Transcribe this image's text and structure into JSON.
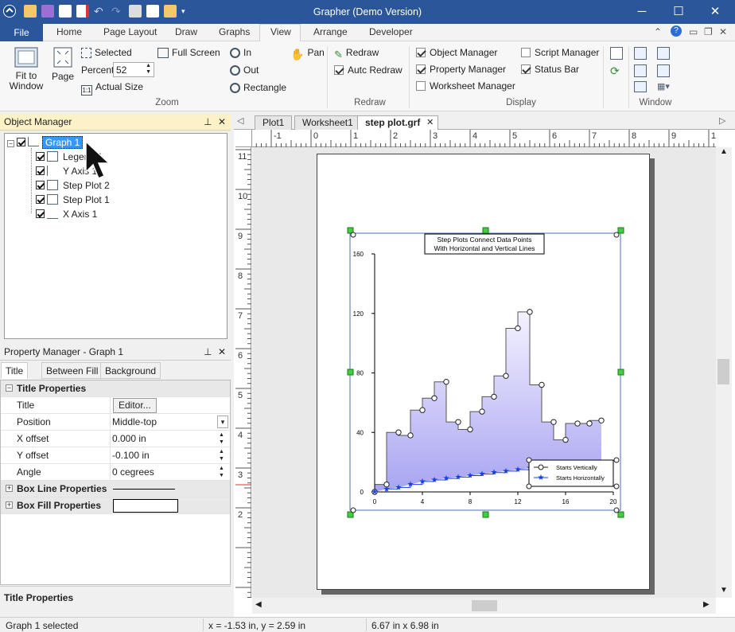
{
  "app": {
    "title": "Grapher (Demo Version)"
  },
  "ribbon_tabs": [
    {
      "label": "File"
    },
    {
      "label": "Home"
    },
    {
      "label": "Page Layout"
    },
    {
      "label": "Draw"
    },
    {
      "label": "Graphs"
    },
    {
      "label": "View"
    },
    {
      "label": "Arrange"
    },
    {
      "label": "Developer"
    }
  ],
  "zoom": {
    "fit_label": "Fit to\nWindow",
    "page_label": "Page",
    "selected_label": "Selected",
    "percent_label": "Percent",
    "percent_value": "52",
    "actual_label": "Actual Size",
    "fullscreen_label": "Full Screen",
    "in_label": "In",
    "out_label": "Out",
    "rect_label": "Rectangle",
    "pan_label": "Pan",
    "group_label": "Zoom"
  },
  "redraw": {
    "redraw_label": "Redraw",
    "auto_label": "Autc Redraw",
    "group_label": "Redraw",
    "auto_checked": true
  },
  "display": {
    "object_manager": "Object Manager",
    "property_manager": "Property Manager",
    "worksheet_manager": "Worksheet Manager",
    "script_manager": "Script Manager",
    "status_bar": "Status Bar",
    "group_label": "Display"
  },
  "window": {
    "group_label": "Window"
  },
  "object_manager": {
    "title": "Object Manager",
    "items": [
      {
        "label": "Graph 1"
      },
      {
        "label": "Legend 1"
      },
      {
        "label": "Y Axis 1"
      },
      {
        "label": "Step Plot 2"
      },
      {
        "label": "Step Plot 1"
      },
      {
        "label": "X Axis 1"
      }
    ]
  },
  "property_manager": {
    "title": "Property Manager - Graph 1",
    "tabs": [
      {
        "label": "Title"
      },
      {
        "label": "Between Fill"
      },
      {
        "label": "Background"
      }
    ],
    "cat_title": "Title Properties",
    "rows": [
      {
        "key": "Title",
        "value": "Editor..."
      },
      {
        "key": "Position",
        "value": "Middle-top"
      },
      {
        "key": "X offset",
        "value": "0.000 in"
      },
      {
        "key": "Y offset",
        "value": "-0.100 in"
      },
      {
        "key": "Angle",
        "value": "0 cegrees"
      }
    ],
    "cat_boxline": "Box Line Properties",
    "cat_boxfill": "Box Fill Properties",
    "footer": "Title Properties"
  },
  "doc_tabs": [
    {
      "label": "Plot1"
    },
    {
      "label": "Worksheet1"
    },
    {
      "label": "step plot.grf"
    }
  ],
  "ruler": {
    "h_ticks": [
      "-1",
      "0",
      "1",
      "2",
      "3",
      "4",
      "5",
      "6",
      "7",
      "8",
      "9",
      "10"
    ],
    "v_ticks": [
      "11",
      "10",
      "9",
      "8",
      "7",
      "6",
      "5",
      "4",
      "3",
      "2"
    ]
  },
  "chart_data": {
    "type": "line",
    "title": "Step Plots Connect Data Points\nWith Horizontal and Vertical Lines",
    "xlim": [
      0,
      20
    ],
    "ylim": [
      0,
      160
    ],
    "x_ticks": [
      0,
      4,
      8,
      12,
      16,
      20
    ],
    "y_ticks": [
      0,
      40,
      80,
      120,
      160
    ],
    "series": [
      {
        "name": "Starts Vertically",
        "marker": "circle",
        "x": [
          0,
          1,
          2,
          3,
          4,
          5,
          6,
          7,
          8,
          9,
          10,
          11,
          12,
          13,
          14,
          15,
          16,
          17,
          18,
          19
        ],
        "y": [
          0,
          5,
          40,
          38,
          55,
          63,
          74,
          47,
          42,
          54,
          64,
          78,
          110,
          121,
          72,
          47,
          35,
          46,
          46,
          48
        ]
      },
      {
        "name": "Starts Horizontally",
        "marker": "star",
        "x": [
          0,
          1,
          2,
          3,
          4,
          5,
          6,
          7,
          8,
          9,
          10,
          11,
          12,
          13,
          14
        ],
        "y": [
          0,
          2,
          3,
          5,
          7,
          8,
          9,
          10,
          11,
          12,
          13,
          14,
          15,
          16,
          17
        ]
      }
    ],
    "legend_position": "bottom-right",
    "colors": {
      "vertical": "#555555",
      "horizontal": "#1a3fe0",
      "fill_top": "#f4f2ff",
      "fill_bottom": "#a8a4f2"
    }
  },
  "status": {
    "selection": "Graph 1 selected",
    "coords": "x = -1.53 in, y = 2.59 in",
    "size": "6.67 in x 6.98 in"
  }
}
